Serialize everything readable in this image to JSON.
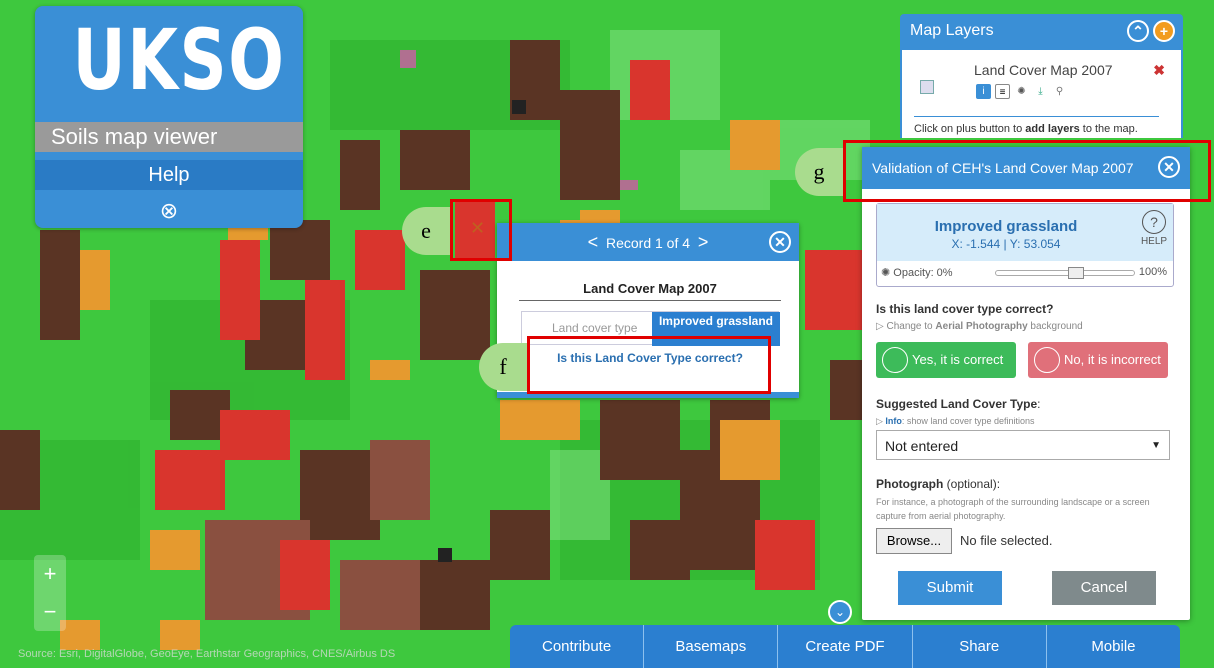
{
  "brand": {
    "title": "UKSO",
    "subtitle": "Soils map viewer",
    "help": "Help"
  },
  "layers": {
    "title": "Map Layers",
    "layer_name": "Land Cover Map 2007",
    "hint_pre": "Click on plus button to ",
    "hint_bold": "add layers",
    "hint_post": " to the map."
  },
  "popup": {
    "nav": "Record 1 of 4",
    "title": "Land Cover Map 2007",
    "key": "Land cover type",
    "value": "Improved grassland",
    "link": "Is this Land Cover Type correct?"
  },
  "validation": {
    "title": "Validation of CEH's Land Cover Map 2007",
    "class": "Improved grassland",
    "coords": "X: -1.544 | Y: 53.054",
    "help": "HELP",
    "opacity_label": "Opacity: 0%",
    "opacity_max": "100%",
    "opacity_level": 0.58,
    "question": "Is this land cover type correct?",
    "change_pre": "▷ Change to ",
    "change_bold": "Aerial Photography",
    "change_post": " background",
    "yes": "Yes, it is correct",
    "no": "No, it is incorrect",
    "suggested": "Suggested Land Cover Type",
    "suggested_colon": ":",
    "info_bold": "Info",
    "info_rest": ": show land cover type definitions",
    "info_prefix": "▷ ",
    "select_value": "Not entered",
    "photo": "Photograph",
    "photo_opt": " (optional):",
    "photo_desc": "For instance, a photograph of the surrounding landscape or a screen capture from aerial photography.",
    "browse": "Browse...",
    "no_file": "No file selected.",
    "submit": "Submit",
    "cancel": "Cancel"
  },
  "annotations": {
    "e": "e",
    "f": "f",
    "g": "g"
  },
  "bottom_bar": [
    "Contribute",
    "Basemaps",
    "Create PDF",
    "Share",
    "Mobile"
  ],
  "attribution": "Source: Esri, DigitalGlobe, GeoEye, Earthstar Geographics, CNES/Airbus DS",
  "zoom": {
    "in": "+",
    "out": "−"
  },
  "colors": {
    "accent": "#3a8fd6",
    "yes": "#3dbb5a",
    "no": "#e0707a",
    "annotation": "#e00000",
    "grass": "#3ec83e"
  }
}
